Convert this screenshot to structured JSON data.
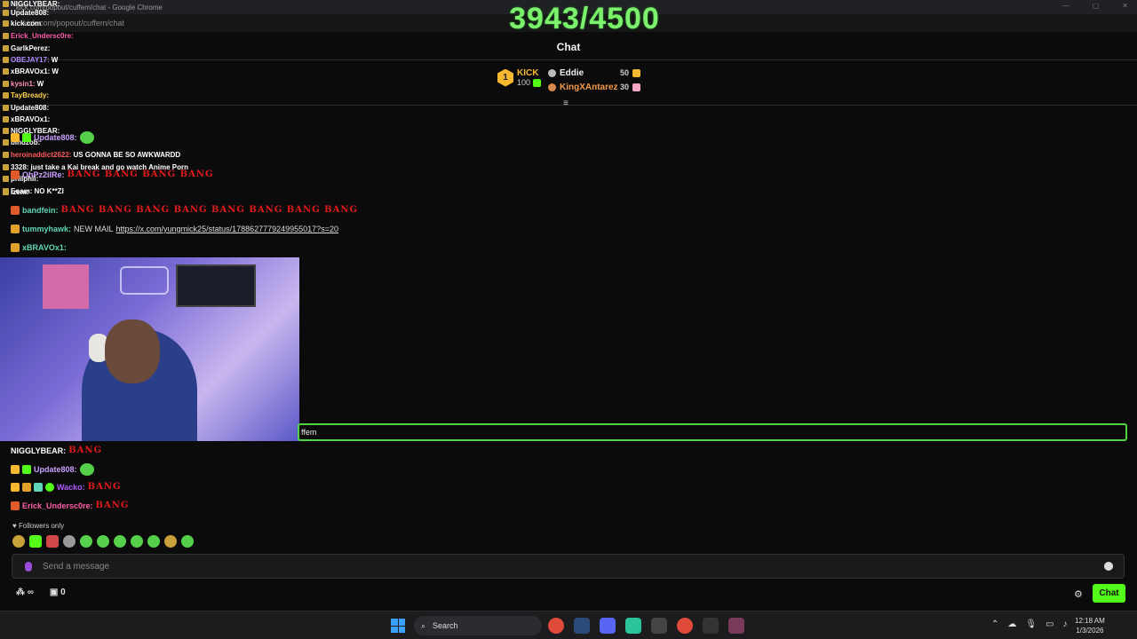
{
  "window": {
    "title": "kick.com/popout/cuffem/chat - Google Chrome",
    "url": "kick.com/popout/cuffem/chat"
  },
  "goal": {
    "text": "3943/4500"
  },
  "header": {
    "title": "Chat"
  },
  "leaderboard": {
    "top": {
      "rank": "1",
      "name": "KICK",
      "points": "100"
    },
    "second": {
      "name": "Eddie",
      "points": "50"
    },
    "third": {
      "name": "KingXAntarez",
      "points": "30"
    }
  },
  "overlay_feed": [
    {
      "user": "NIGGLYBEAR:",
      "text": "",
      "color": "#ffffff"
    },
    {
      "user": "Update808:",
      "text": "",
      "color": "#ffffff"
    },
    {
      "user": "kick.com",
      "text": "",
      "color": "#ffffff"
    },
    {
      "user": "Erick_Undersc0re:",
      "text": "",
      "color": "#ff5ca8"
    },
    {
      "user": "GarlkPerez:",
      "text": "",
      "color": "#ffffff"
    },
    {
      "user": "OBEJAY17:",
      "text": "W",
      "color": "#b18cff"
    },
    {
      "user": "xBRAVOx1:",
      "text": "W",
      "color": "#ffffff"
    },
    {
      "user": "kysin1:",
      "text": "W",
      "color": "#ff8fb7"
    },
    {
      "user": "TayBready:",
      "text": "",
      "color": "#ffd54a"
    },
    {
      "user": "Update808:",
      "text": "",
      "color": "#ffffff"
    },
    {
      "user": "xBRAVOx1:",
      "text": "",
      "color": "#ffffff"
    },
    {
      "user": "NIGGLYBEAR:",
      "text": "",
      "color": "#ffffff"
    },
    {
      "user": "bindzob:",
      "text": "",
      "color": "#ffffff"
    },
    {
      "user": "heroinaddict2622:",
      "text": "US GONNA BE SO AWKWARDD",
      "color": "#ff5a5a"
    },
    {
      "user": "3328:",
      "text": "just take a Kai break and go watch Anime Porn",
      "color": "#ffffff"
    },
    {
      "user": "philphil:",
      "text": "",
      "color": "#ffffff"
    },
    {
      "user": "Eoam:",
      "text": "NO K**ZI",
      "color": "#ffffff"
    },
    {
      "user": "lzem:",
      "text": "",
      "color": "#ffffff"
    }
  ],
  "messages": [
    {
      "user": "Update808:",
      "text": "",
      "color": "#c9a0ff"
    },
    {
      "user": "OhPz2ilRe:",
      "text": "BANG BANG BANG BANG",
      "color": "#c9a0ff"
    },
    {
      "user": "bandfein:",
      "text": "BANG BANG BANG BANG BANG BANG BANG BANG",
      "color": "#5fd6b5"
    },
    {
      "user": "tummyhawk:",
      "text": "NEW MAIL",
      "link": "https://x.com/yungmick25/status/1788627779249955017?s=20",
      "color": "#5fd6b5"
    },
    {
      "user": "xBRAVOx1:",
      "text": "",
      "color": "#5fd6b5"
    },
    {
      "user": "NIGGLYBEAR:",
      "text": "BANG",
      "color": "#ffffff"
    },
    {
      "user": "Update808:",
      "text": "",
      "color": "#c9a0ff"
    },
    {
      "user": "Wacko:",
      "text": "BANG",
      "color": "#b25cff"
    },
    {
      "user": "Erick_Undersc0re:",
      "text": "BANG",
      "color": "#ff5ca8"
    }
  ],
  "chat_input_overlay": {
    "text": "ffem"
  },
  "followers": {
    "label": "Followers only"
  },
  "send": {
    "placeholder": "Send a message"
  },
  "bottom": {
    "gift_count": "0",
    "chat_button": "Chat"
  },
  "taskbar": {
    "search": "Search",
    "time": "12:18 AM",
    "date": "1/3/2026"
  },
  "colors": {
    "accent": "#53fc18",
    "goal": "#7cf26c",
    "bang": "#e01a1a"
  }
}
